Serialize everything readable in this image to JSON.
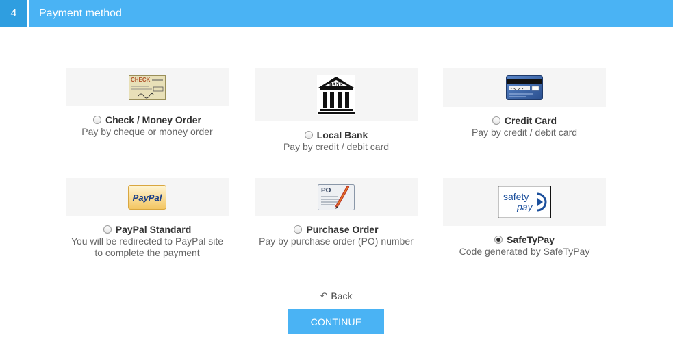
{
  "step": {
    "number": "4",
    "title": "Payment method"
  },
  "methods": [
    {
      "title": "Check / Money Order",
      "desc": [
        "Pay by cheque or money order"
      ],
      "selected": false,
      "icon": "check-icon",
      "check_text": "CHECK"
    },
    {
      "title": "Local Bank",
      "desc": [
        "Pay by credit / debit card"
      ],
      "selected": false,
      "icon": "bank-icon",
      "logo_text": "BANK"
    },
    {
      "title": "Credit Card",
      "desc": [
        "Pay by credit / debit card"
      ],
      "selected": false,
      "icon": "credit-card-icon"
    },
    {
      "title": "PayPal Standard",
      "desc": [
        "You will be redirected to PayPal site",
        "to complete the payment"
      ],
      "selected": false,
      "icon": "paypal-icon",
      "logo_text": "PayPal"
    },
    {
      "title": "Purchase Order",
      "desc": [
        "Pay by purchase order (PO) number"
      ],
      "selected": false,
      "icon": "purchase-order-icon",
      "logo_text": "PO"
    },
    {
      "title": "SafeTyPay",
      "desc": [
        "Code generated by SafeTyPay"
      ],
      "selected": true,
      "icon": "safetypay-icon",
      "logo_line1": "safety",
      "logo_line2": "pay"
    }
  ],
  "back_label": "Back",
  "continue_label": "CONTINUE",
  "colors": {
    "accent": "#4ab3f4",
    "step_number_bg": "#2f9ee0"
  }
}
